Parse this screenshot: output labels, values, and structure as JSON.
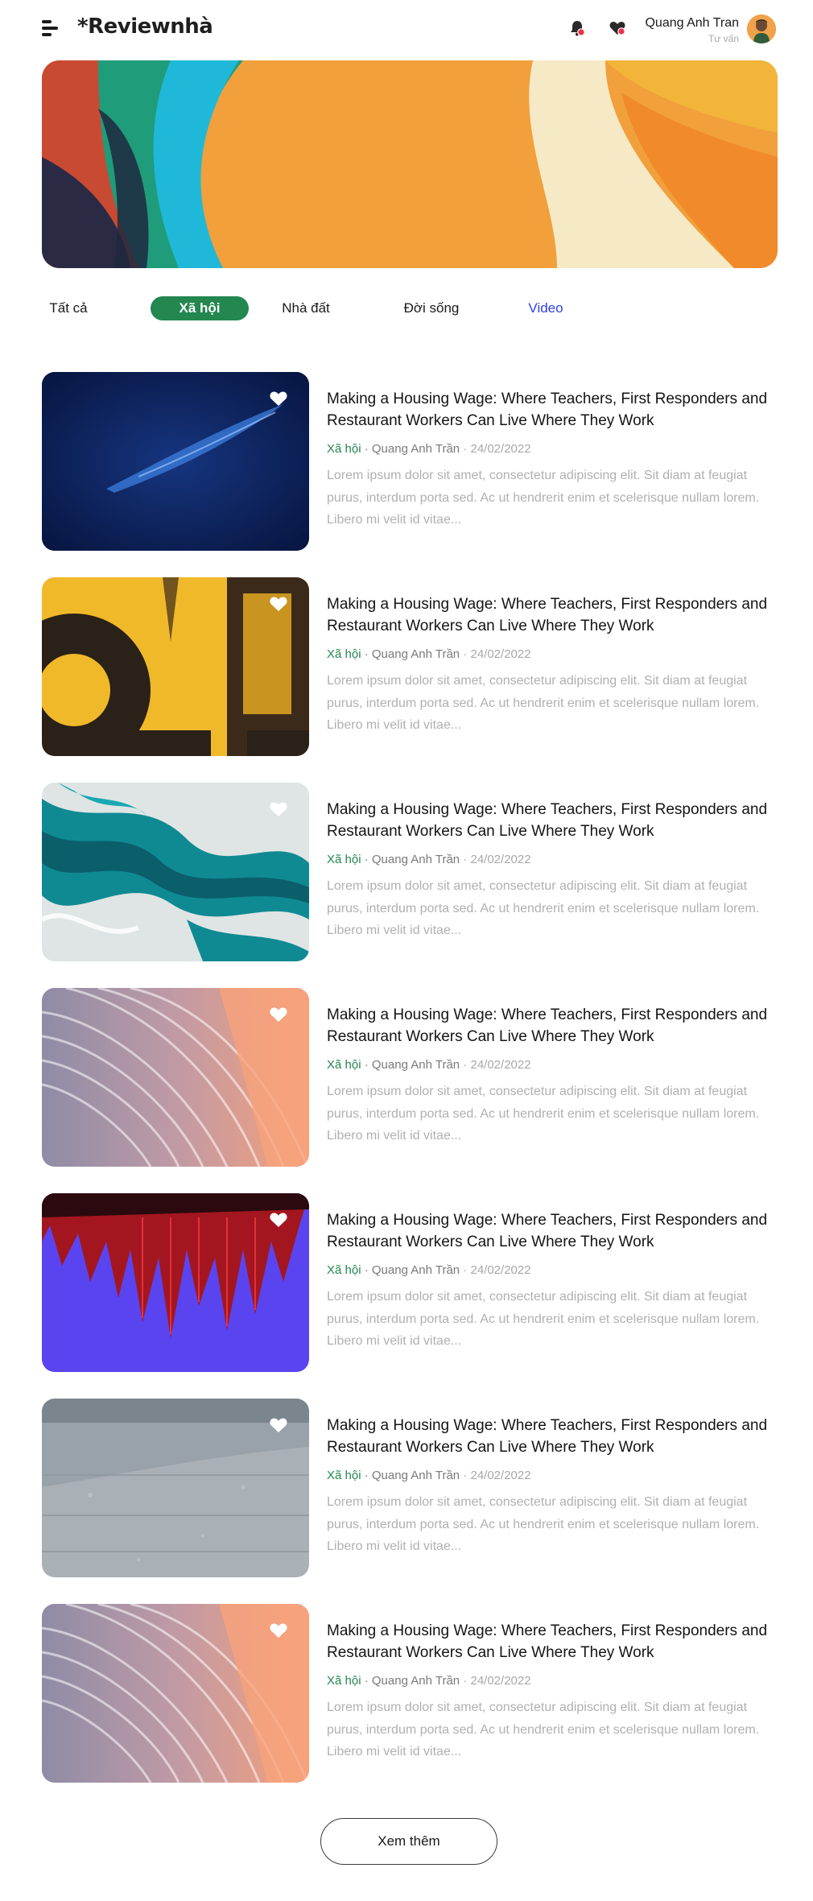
{
  "header": {
    "logo": "*Reviewnhà",
    "menu_icon": "menu-icon",
    "notification_icon": "bell-icon",
    "favorites_icon": "heart-icon",
    "user": {
      "name": "Quang Anh Tran",
      "role": "Tư vấn"
    },
    "accent_red": "#e8344a"
  },
  "tabs": [
    {
      "label": "Tất cả",
      "active": false
    },
    {
      "label": "Xã hội",
      "active": true
    },
    {
      "label": "Nhà đất",
      "active": false
    },
    {
      "label": "Đời sống",
      "active": false
    },
    {
      "label": "Video",
      "active": false
    }
  ],
  "articles": [
    {
      "title": "Making a Housing Wage: Where Teachers, First Responders and Restaurant Workers Can Live Where They Work",
      "category": "Xã hội",
      "author": "Quang Anh Trần",
      "date": "24/02/2022",
      "excerpt": "Lorem ipsum dolor sit amet, consectetur adipiscing elit. Sit diam at feugiat purus, interdum porta sed. Ac ut hendrerit enim et scelerisque nullam lorem. Libero mi velit id vitae...",
      "image": "navy-texture"
    },
    {
      "title": "Making a Housing Wage: Where Teachers, First Responders and Restaurant Workers Can Live Where They Work",
      "category": "Xã hội",
      "author": "Quang Anh Trần",
      "date": "24/02/2022",
      "excerpt": "Lorem ipsum dolor sit amet, consectetur adipiscing elit. Sit diam at feugiat purus, interdum porta sed. Ac ut hendrerit enim et scelerisque nullam lorem. Libero mi velit id vitae...",
      "image": "yellow-grunge"
    },
    {
      "title": "Making a Housing Wage: Where Teachers, First Responders and Restaurant Workers Can Live Where They Work",
      "category": "Xã hội",
      "author": "Quang Anh Trần",
      "date": "24/02/2022",
      "excerpt": "Lorem ipsum dolor sit amet, consectetur adipiscing elit. Sit diam at feugiat purus, interdum porta sed. Ac ut hendrerit enim et scelerisque nullam lorem. Libero mi velit id vitae...",
      "image": "teal-marble"
    },
    {
      "title": "Making a Housing Wage: Where Teachers, First Responders and Restaurant Workers Can Live Where They Work",
      "category": "Xã hội",
      "author": "Quang Anh Trần",
      "date": "24/02/2022",
      "excerpt": "Lorem ipsum dolor sit amet, consectetur adipiscing elit. Sit diam at feugiat purus, interdum porta sed. Ac ut hendrerit enim et scelerisque nullam lorem. Libero mi velit id vitae...",
      "image": "peach-curves"
    },
    {
      "title": "Making a Housing Wage: Where Teachers, First Responders and Restaurant Workers Can Live Where They Work",
      "category": "Xã hội",
      "author": "Quang Anh Trần",
      "date": "24/02/2022",
      "excerpt": "Lorem ipsum dolor sit amet, consectetur adipiscing elit. Sit diam at feugiat purus, interdum porta sed. Ac ut hendrerit enim et scelerisque nullam lorem. Libero mi velit id vitae...",
      "image": "red-spikes-purple"
    },
    {
      "title": "Making a Housing Wage: Where Teachers, First Responders and Restaurant Workers Can Live Where They Work",
      "category": "Xã hội",
      "author": "Quang Anh Trần",
      "date": "24/02/2022",
      "excerpt": "Lorem ipsum dolor sit amet, consectetur adipiscing elit. Sit diam at feugiat purus, interdum porta sed. Ac ut hendrerit enim et scelerisque nullam lorem. Libero mi velit id vitae...",
      "image": "grey-wall"
    },
    {
      "title": "Making a Housing Wage: Where Teachers, First Responders and Restaurant Workers Can Live Where They Work",
      "category": "Xã hội",
      "author": "Quang Anh Trần",
      "date": "24/02/2022",
      "excerpt": "Lorem ipsum dolor sit amet, consectetur adipiscing elit. Sit diam at feugiat purus, interdum porta sed. Ac ut hendrerit enim et scelerisque nullam lorem. Libero mi velit id vitae...",
      "image": "peach-curves"
    }
  ],
  "load_more": {
    "label": "Xem thêm"
  },
  "colors": {
    "accent_green": "#23874f",
    "video_blue": "#2f3fe0",
    "muted_text": "#b0b0b0"
  }
}
